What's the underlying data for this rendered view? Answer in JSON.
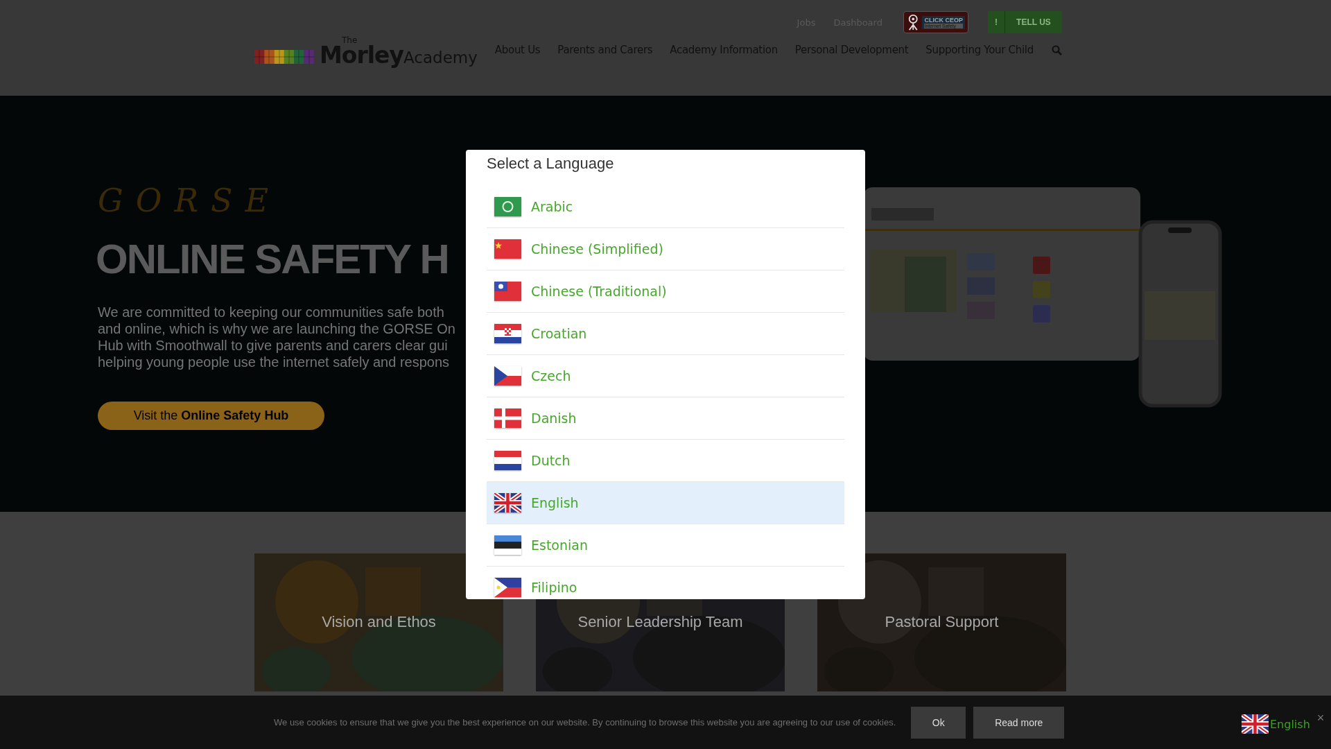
{
  "header": {
    "logo": {
      "small": "The",
      "name": "Morley",
      "suffix": "Academy"
    },
    "top_links": [
      "Jobs",
      "Dashboard"
    ],
    "ceop_badge": {
      "title": "CLICK CEOP",
      "subtitle": "Internet Safety"
    },
    "report_button": {
      "mark": "!",
      "label": "TELL US"
    },
    "nav": [
      "About Us",
      "Parents and Carers",
      "Academy Information",
      "Personal Development",
      "Supporting Your Child"
    ]
  },
  "hero": {
    "brand": "GORSE",
    "title": "ONLINE SAFETY H",
    "lines": [
      "We are committed to keeping our communities safe both",
      "and online, which is why we are launching the GORSE On",
      "Hub with Smoothwall to give parents and carers clear gui",
      "helping young people use the internet safely and respons"
    ],
    "button": "Visit the **Online Safety Hub**"
  },
  "cards": [
    {
      "title": "Vision and Ethos"
    },
    {
      "title": "Senior Leadership Team"
    },
    {
      "title": "Pastoral Support"
    }
  ],
  "cookie_bar": {
    "text": "We use cookies to ensure that we give you the best experience on our website. By continuing to browse this website you are agreeing to our use of cookies.",
    "buttons": [
      "Ok",
      "Read more"
    ]
  },
  "language_widget": {
    "label": "English",
    "close": "×"
  },
  "language_dialog": {
    "title": "Select a Language",
    "languages": [
      {
        "name": "Arabic",
        "selected": false
      },
      {
        "name": "Chinese (Simplified)",
        "selected": false
      },
      {
        "name": "Chinese (Traditional)",
        "selected": false
      },
      {
        "name": "Croatian",
        "selected": false
      },
      {
        "name": "Czech",
        "selected": false
      },
      {
        "name": "Danish",
        "selected": false
      },
      {
        "name": "Dutch",
        "selected": false
      },
      {
        "name": "English",
        "selected": true
      },
      {
        "name": "Estonian",
        "selected": false
      },
      {
        "name": "Filipino",
        "selected": false
      }
    ]
  }
}
